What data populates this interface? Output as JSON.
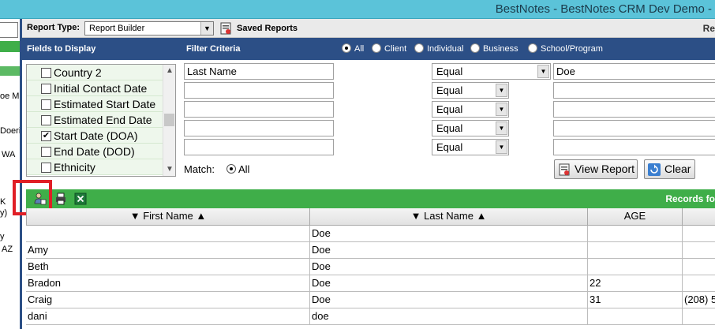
{
  "window": {
    "title": "BestNotes - BestNotes CRM Dev Demo -"
  },
  "left_panel": {
    "fragments": [
      "oe Ma",
      "Doerin",
      "WA",
      "K",
      "y)",
      "y",
      "AZ"
    ]
  },
  "report_bar": {
    "report_type_label": "Report Type:",
    "report_type_value": "Report Builder",
    "saved_reports_label": "Saved Reports",
    "right_text": "Re"
  },
  "header": {
    "fields_to_display": "Fields to Display",
    "filter_criteria": "Filter Criteria",
    "radio_options": [
      {
        "label": "All",
        "selected": true
      },
      {
        "label": "Client",
        "selected": false
      },
      {
        "label": "Individual",
        "selected": false
      },
      {
        "label": "Business",
        "selected": false
      },
      {
        "label": "School/Program",
        "selected": false
      }
    ]
  },
  "fields": [
    {
      "label": "Country 2",
      "checked": false
    },
    {
      "label": "Initial Contact Date",
      "checked": false
    },
    {
      "label": "Estimated Start Date",
      "checked": false
    },
    {
      "label": "Estimated End Date",
      "checked": false
    },
    {
      "label": "Start Date (DOA)",
      "checked": true
    },
    {
      "label": "End Date (DOD)",
      "checked": false
    },
    {
      "label": "Ethnicity",
      "checked": false
    }
  ],
  "filters": [
    {
      "field": "Last Name",
      "operator": "Equal",
      "value": "Doe"
    },
    {
      "field": "",
      "operator": "Equal",
      "value": ""
    },
    {
      "field": "",
      "operator": "Equal",
      "value": ""
    },
    {
      "field": "",
      "operator": "Equal",
      "value": ""
    },
    {
      "field": "",
      "operator": "Equal",
      "value": ""
    }
  ],
  "match": {
    "label": "Match:",
    "value": "All"
  },
  "buttons": {
    "view_report": "View Report",
    "clear": "Clear"
  },
  "toolbar": {
    "records_text": "Records fo"
  },
  "table": {
    "columns": [
      "First Name",
      "Last Name",
      "AGE",
      ""
    ],
    "rows": [
      [
        "",
        "Doe",
        "",
        ""
      ],
      [
        "Amy",
        "Doe",
        "",
        ""
      ],
      [
        "Beth",
        "Doe",
        "",
        ""
      ],
      [
        "Bradon",
        "Doe",
        "22",
        ""
      ],
      [
        "Craig",
        "Doe",
        "31",
        "(208) 5"
      ],
      [
        "dani",
        "doe",
        "",
        ""
      ]
    ]
  },
  "colors": {
    "title_bar": "#5bc3d9",
    "header_band": "#2c4f86",
    "green_bar": "#3fae49",
    "highlight": "#e01f26"
  }
}
